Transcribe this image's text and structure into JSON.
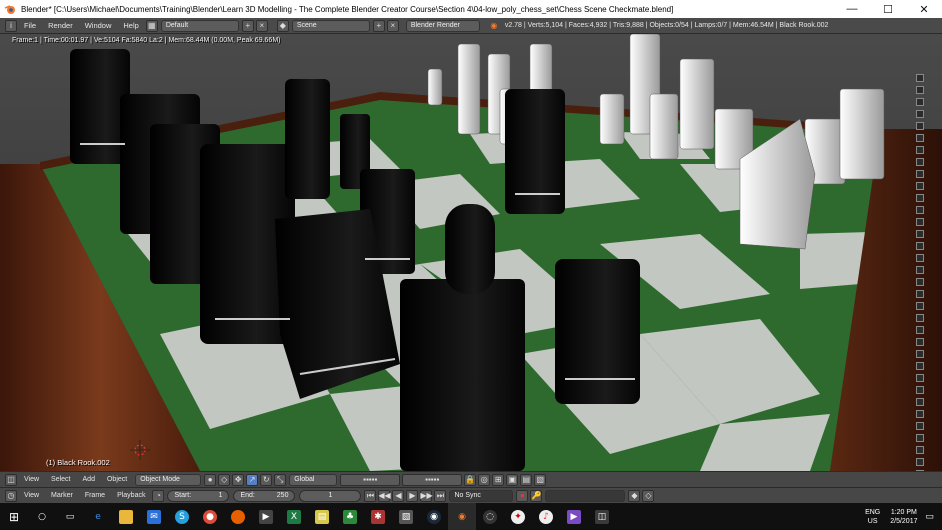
{
  "window": {
    "title": "Blender* [C:\\Users\\Michael\\Documents\\Training\\Blender\\Learn 3D Modelling - The Complete Blender Creator Course\\Section 4\\04-low_poly_chess_set\\Chess Scene Checkmate.blend]",
    "minimize": "—",
    "maximize": "☐",
    "close": "✕"
  },
  "menubar": {
    "items": [
      "File",
      "Render",
      "Window",
      "Help"
    ],
    "layout": "Default",
    "scene": "Scene",
    "engine": "Blender Render",
    "stats": "v2.78 | Verts:5,104 | Faces:4,932 | Tris:9,888 | Objects:0/54 | Lamps:0/7 | Mem:46.54M | Black Rook.002"
  },
  "viewport": {
    "render_info": "Frame:1 | Time:00:01.97 | Ve:5104 Fa:5840 La:2 | Mem:68.44M (0.00M, Peak 69.66M)",
    "active_object": "(1) Black Rook.002"
  },
  "view3d_header": {
    "menus": [
      "View",
      "Select",
      "Add",
      "Object"
    ],
    "mode": "Object Mode",
    "orientation": "Global"
  },
  "timeline": {
    "menus": [
      "View",
      "Marker",
      "Frame",
      "Playback"
    ],
    "start_label": "Start:",
    "start": "1",
    "end_label": "End:",
    "end": "250",
    "current": "1",
    "sync": "No Sync"
  },
  "taskbar": {
    "lang_top": "ENG",
    "lang_bottom": "US",
    "time": "1:20 PM",
    "date": "2/5/2017"
  },
  "colors": {
    "board_light": "#d6d6d6",
    "board_dark": "#2f6e2f",
    "wood": "#6b2f14",
    "black_piece": "#0c0c0c",
    "white_piece": "#e8e8e8"
  }
}
